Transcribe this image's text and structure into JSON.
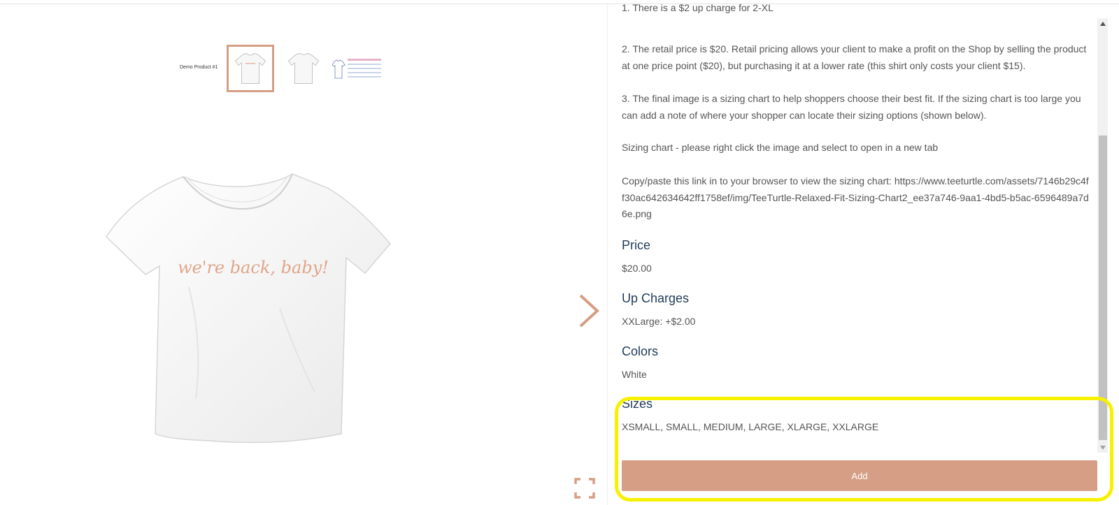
{
  "gallery": {
    "thumb_label": "Demo Product #1",
    "shirt_print": "we're back, baby!"
  },
  "description": [
    "1. There is a $2 up charge for 2-XL",
    "2. The retail price is $20. Retail pricing allows your client to make a profit on the Shop by selling the product at one price point ($20), but purchasing it at a lower rate (this shirt only costs your client $15).",
    "3. The final image is a sizing chart to help shoppers choose their best fit. If the sizing chart is too large you can add a note of where your shopper can locate their sizing options (shown below).",
    "Sizing chart - please right click the image and select to open in a new tab",
    "Copy/paste this link in to your browser to view the sizing chart: https://www.teeturtle.com/assets/7146b29c4ff30ac642634642ff1758ef/img/TeeTurtle-Relaxed-Fit-Sizing-Chart2_ee37a746-9aa1-4bd5-b5ac-6596489a7d6e.png"
  ],
  "sections": {
    "price": {
      "title": "Price",
      "value": "$20.00"
    },
    "up_charges": {
      "title": "Up Charges",
      "value": "XXLarge: +$2.00"
    },
    "colors": {
      "title": "Colors",
      "value": "White"
    },
    "sizes": {
      "title": "Sizes",
      "value": "XSMALL, SMALL, MEDIUM, LARGE, XLARGE, XXLARGE"
    }
  },
  "actions": {
    "add_label": "Add"
  },
  "theme": {
    "accent": "#d69e85",
    "heading": "#1f3a56",
    "highlight": "#f7f100"
  },
  "icons": [
    "chevron-right-icon",
    "fullscreen-icon",
    "scroll-up-icon",
    "scroll-down-icon"
  ]
}
